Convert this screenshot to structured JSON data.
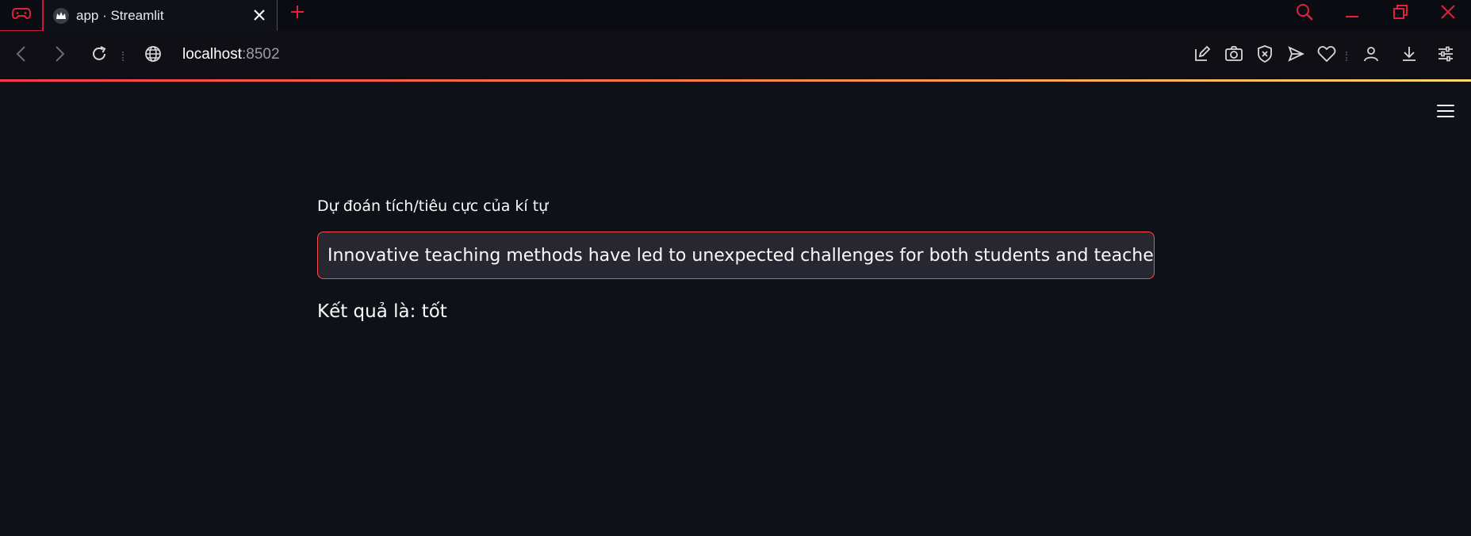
{
  "tabs": [
    {
      "title": "app · Streamlit"
    }
  ],
  "address_bar": {
    "host": "localhost",
    "port": ":8502"
  },
  "colors": {
    "accent": "#ff4b4b",
    "browser_accent": "#c8193c",
    "background": "#0e1117",
    "input_background": "#262730"
  },
  "icons": {
    "gx_corner": "gamepad-icon",
    "favicon": "streamlit-crown-icon",
    "toolbar": [
      "snapshot-edit-icon",
      "camera-icon",
      "shield-icon",
      "send-icon",
      "heart-icon",
      "profile-icon",
      "download-icon",
      "settings-sliders-icon"
    ]
  },
  "main": {
    "input_label": "Dự đoán tích/tiêu cực của kí tự",
    "input_value": "Innovative teaching methods have led to unexpected challenges for both students and teachers",
    "result_text": "Kết quả là: tốt"
  }
}
